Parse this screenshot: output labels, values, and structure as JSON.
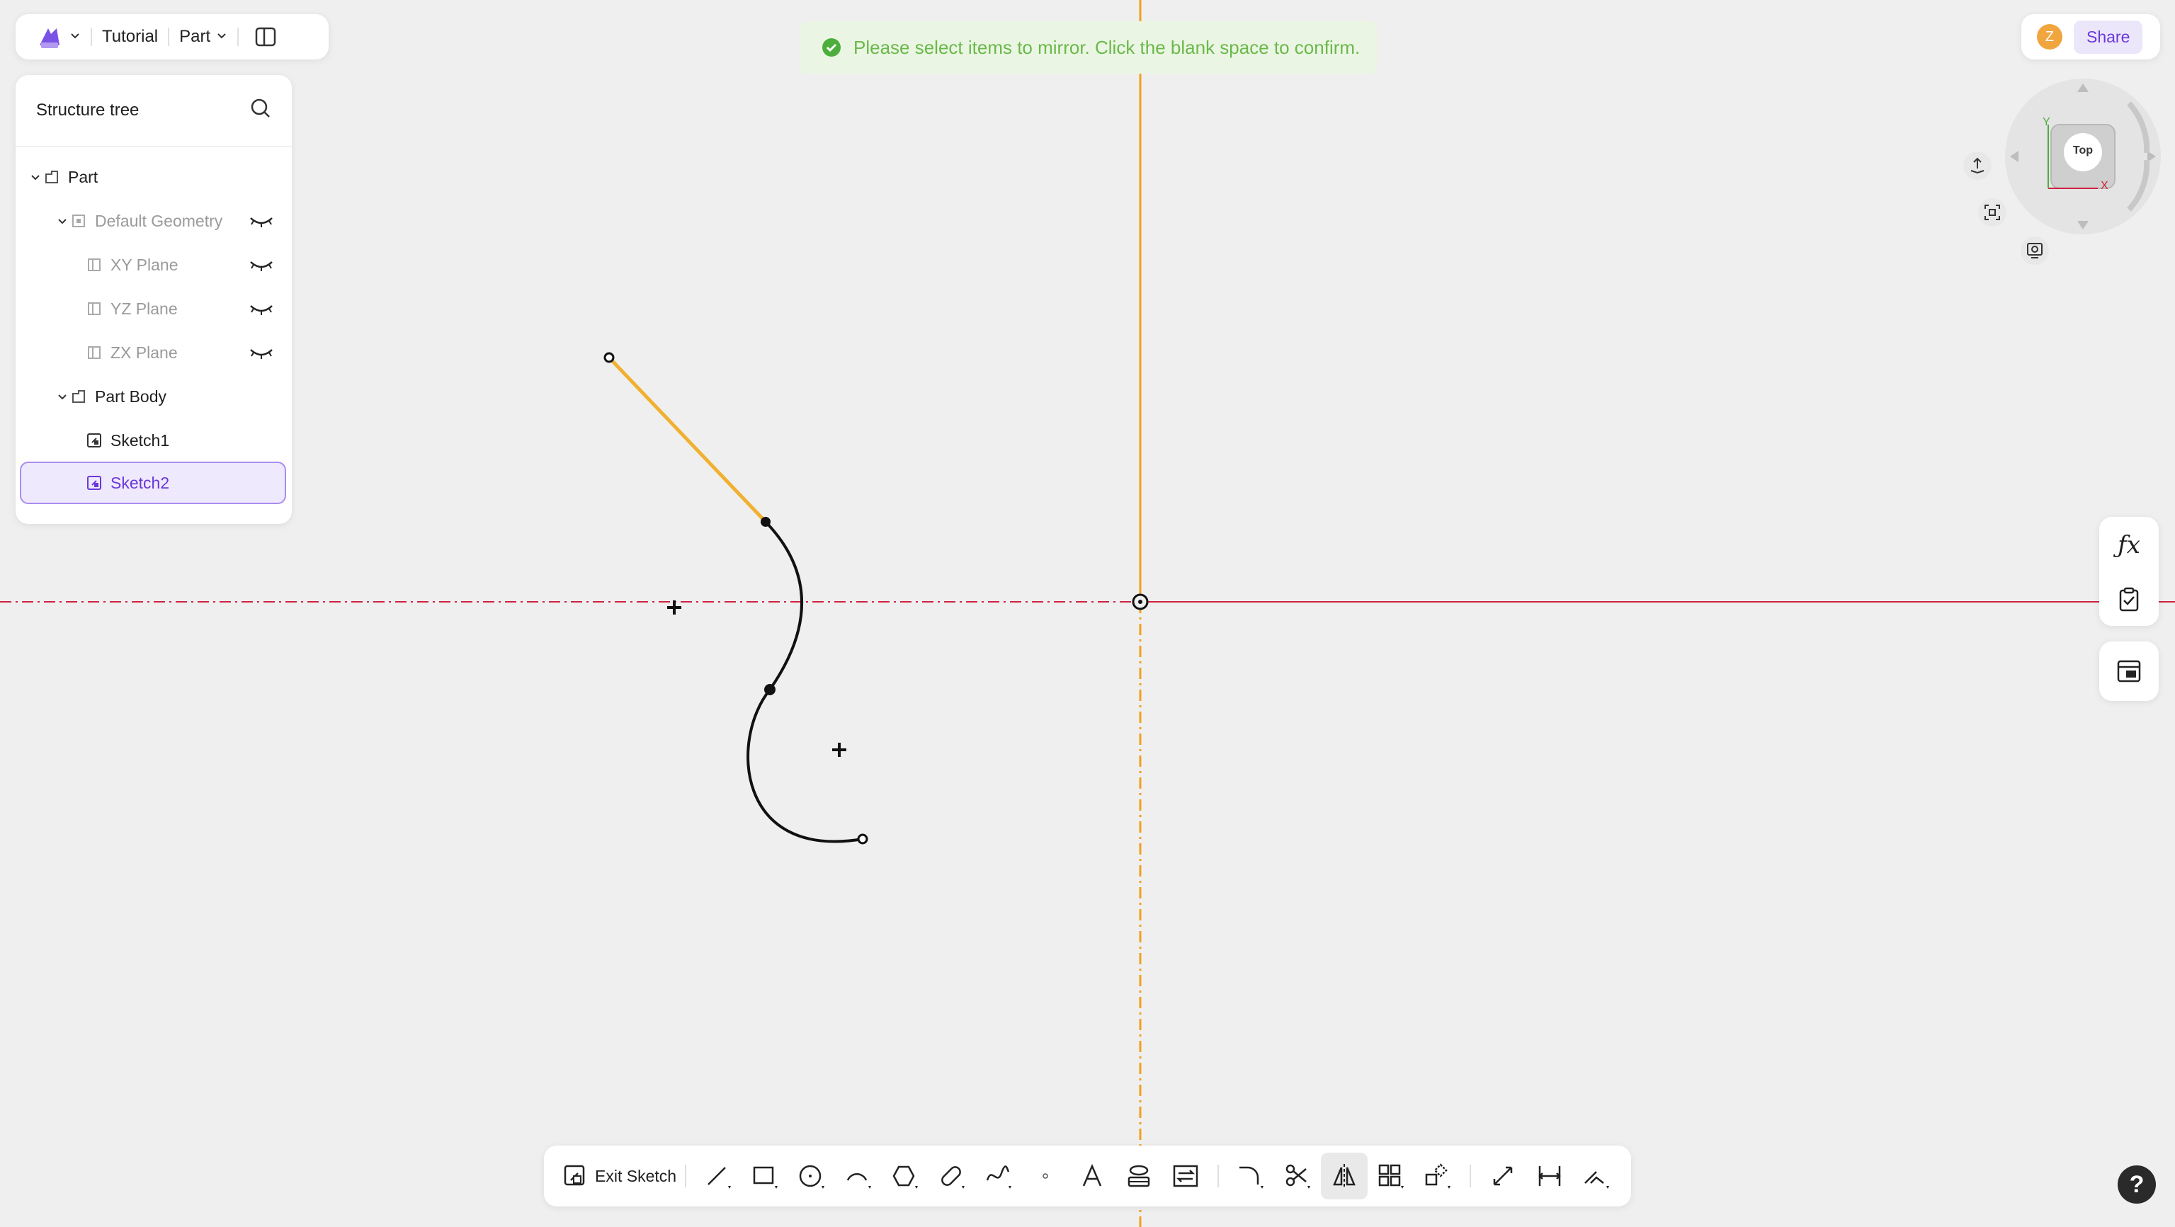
{
  "header": {
    "project_name": "Tutorial",
    "mode_label": "Part"
  },
  "tree": {
    "title": "Structure tree",
    "items": [
      {
        "label": "Part"
      },
      {
        "label": "Default Geometry"
      },
      {
        "label": "XY Plane"
      },
      {
        "label": "YZ Plane"
      },
      {
        "label": "ZX Plane"
      },
      {
        "label": "Part Body"
      },
      {
        "label": "Sketch1"
      },
      {
        "label": "Sketch2"
      }
    ]
  },
  "notification": {
    "message": "Please select items to mirror. Click the blank space to confirm."
  },
  "user": {
    "avatar_initial": "Z",
    "share_label": "Share"
  },
  "view_cube": {
    "face_label": "Top",
    "axis_x": "X",
    "axis_y": "Y"
  },
  "toolbar": {
    "exit_label": "Exit Sketch"
  },
  "help": {
    "label": "?"
  },
  "colors": {
    "accent": "#6a38d8",
    "axis_vertical": "#f0a020",
    "axis_horizontal": "#d02040",
    "selected_line": "#f0b030",
    "success": "#6bb84a"
  }
}
